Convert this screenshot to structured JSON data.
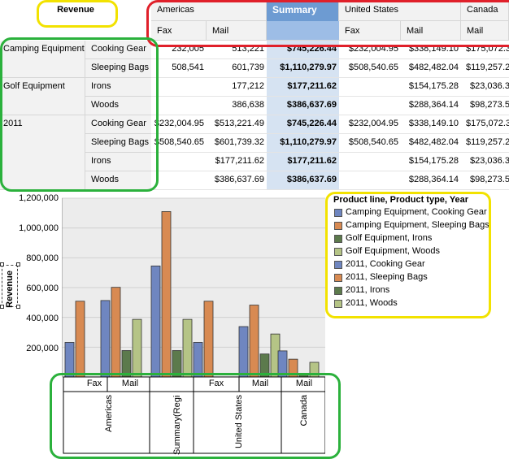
{
  "pivot": {
    "measure_label": "Revenue",
    "columns": [
      "Americas",
      "Summary",
      "United States",
      "Canada"
    ],
    "subcolumns": [
      "Fax",
      "Mail",
      "Fax",
      "Mail",
      "Mail"
    ],
    "row_groups": [
      {
        "label": "Camping Equipment"
      },
      {
        "label": "Golf Equipment"
      },
      {
        "label": "2011"
      }
    ],
    "rows": [
      {
        "type": "Cooking Gear",
        "cells": [
          "232,005",
          "513,221",
          "$745,226.44",
          "$232,004.95",
          "$338,149.10",
          "$175,072.3"
        ]
      },
      {
        "type": "Sleeping Bags",
        "cells": [
          "508,541",
          "601,739",
          "$1,110,279.97",
          "$508,540.65",
          "$482,482.04",
          "$119,257.2"
        ]
      },
      {
        "type": "Irons",
        "cells": [
          "",
          "177,212",
          "$177,211.62",
          "",
          "$154,175.28",
          "$23,036.3"
        ]
      },
      {
        "type": "Woods",
        "cells": [
          "",
          "386,638",
          "$386,637.69",
          "",
          "$288,364.14",
          "$98,273.5"
        ]
      },
      {
        "type": "Cooking Gear",
        "cells": [
          "$232,004.95",
          "$513,221.49",
          "$745,226.44",
          "$232,004.95",
          "$338,149.10",
          "$175,072.3"
        ]
      },
      {
        "type": "Sleeping Bags",
        "cells": [
          "$508,540.65",
          "$601,739.32",
          "$1,110,279.97",
          "$508,540.65",
          "$482,482.04",
          "$119,257.2"
        ]
      },
      {
        "type": "Irons",
        "cells": [
          "",
          "$177,211.62",
          "$177,211.62",
          "",
          "$154,175.28",
          "$23,036.3"
        ]
      },
      {
        "type": "Woods",
        "cells": [
          "",
          "$386,637.69",
          "$386,637.69",
          "",
          "$288,364.14",
          "$98,273.5"
        ]
      }
    ]
  },
  "chart_data": {
    "type": "bar",
    "ylabel": "Revenue",
    "ylim": [
      0,
      1200000
    ],
    "yticks": [
      "1,200,000",
      "1,000,000",
      "800,000",
      "600,000",
      "400,000",
      "200,000"
    ],
    "legend_title": "Product line, Product type, Year",
    "legend_position": "right",
    "series": [
      {
        "name": "Camping Equipment, Cooking Gear",
        "color": "#6f86c0"
      },
      {
        "name": "Camping Equipment, Sleeping Bags",
        "color": "#d88a52"
      },
      {
        "name": "Golf Equipment, Irons",
        "color": "#5c7a4c"
      },
      {
        "name": "Golf Equipment, Woods",
        "color": "#b5c486"
      },
      {
        "name": "2011, Cooking Gear",
        "color": "#6f86c0"
      },
      {
        "name": "2011, Sleeping Bags",
        "color": "#d88a52"
      },
      {
        "name": "2011, Irons",
        "color": "#5c7a4c"
      },
      {
        "name": "2011, Woods",
        "color": "#b5c486"
      }
    ],
    "groups": [
      {
        "label": "Fax",
        "values": [
          232005,
          508541,
          0,
          0
        ]
      },
      {
        "label": "Mail",
        "values": [
          513221,
          601739,
          177212,
          386638
        ]
      },
      {
        "label": "",
        "values": [
          745226,
          1110280,
          177212,
          386638
        ]
      },
      {
        "label": "Fax",
        "values": [
          232005,
          508541,
          0,
          0
        ]
      },
      {
        "label": "Mail",
        "values": [
          338149,
          482482,
          154175,
          288364
        ]
      },
      {
        "label": "Mail",
        "values": [
          175072,
          119257,
          23036,
          98274
        ]
      }
    ],
    "x_outer_labels": [
      "Americas",
      "Summary(Region)",
      "United States",
      "Canada"
    ]
  },
  "annotation_colors": {
    "red": "#e0202a",
    "green": "#2bb13c",
    "yellow": "#f2e200"
  }
}
